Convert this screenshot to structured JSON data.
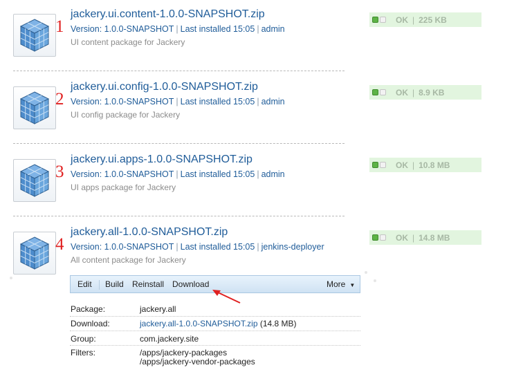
{
  "packages": [
    {
      "marker": "1",
      "title": "jackery.ui.content-1.0.0-SNAPSHOT.zip",
      "version": "Version: 1.0.0-SNAPSHOT",
      "installed": "Last installed 15:05",
      "user": "admin",
      "description": "UI content package for Jackery",
      "status": "OK",
      "size": "225 KB"
    },
    {
      "marker": "2",
      "title": "jackery.ui.config-1.0.0-SNAPSHOT.zip",
      "version": "Version: 1.0.0-SNAPSHOT",
      "installed": "Last installed 15:05",
      "user": "admin",
      "description": "UI config package for Jackery",
      "status": "OK",
      "size": "8.9 KB"
    },
    {
      "marker": "3",
      "title": "jackery.ui.apps-1.0.0-SNAPSHOT.zip",
      "version": "Version: 1.0.0-SNAPSHOT",
      "installed": "Last installed 15:05",
      "user": "admin",
      "description": "UI apps package for Jackery",
      "status": "OK",
      "size": "10.8 MB"
    },
    {
      "marker": "4",
      "title": "jackery.all-1.0.0-SNAPSHOT.zip",
      "version": "Version: 1.0.0-SNAPSHOT",
      "installed": "Last installed 15:05",
      "user": "jenkins-deployer",
      "description": "All content package for Jackery",
      "status": "OK",
      "size": "14.8 MB"
    }
  ],
  "meta_separator": "|",
  "status_separator": "|",
  "toolbar": {
    "edit": "Edit",
    "build": "Build",
    "reinstall": "Reinstall",
    "download": "Download",
    "more": "More",
    "more_caret": "▼"
  },
  "details": {
    "package_label": "Package:",
    "package_value": "jackery.all",
    "download_label": "Download:",
    "download_link": "jackery.all-1.0.0-SNAPSHOT.zip",
    "download_size": "(14.8 MB)",
    "group_label": "Group:",
    "group_value": "com.jackery.site",
    "filters_label": "Filters:",
    "filters": [
      "/apps/jackery-packages",
      "/apps/jackery-vendor-packages"
    ]
  },
  "colors": {
    "link": "#1f5c99",
    "marker": "#e02020",
    "status_bg": "#e2f5df",
    "led_green": "#5db346",
    "toolbar_bg": "#d9e9f7"
  },
  "icons": {
    "package": "package-cube-icon",
    "status_ok": "status-led-icon",
    "arrow": "arrow-icon"
  }
}
